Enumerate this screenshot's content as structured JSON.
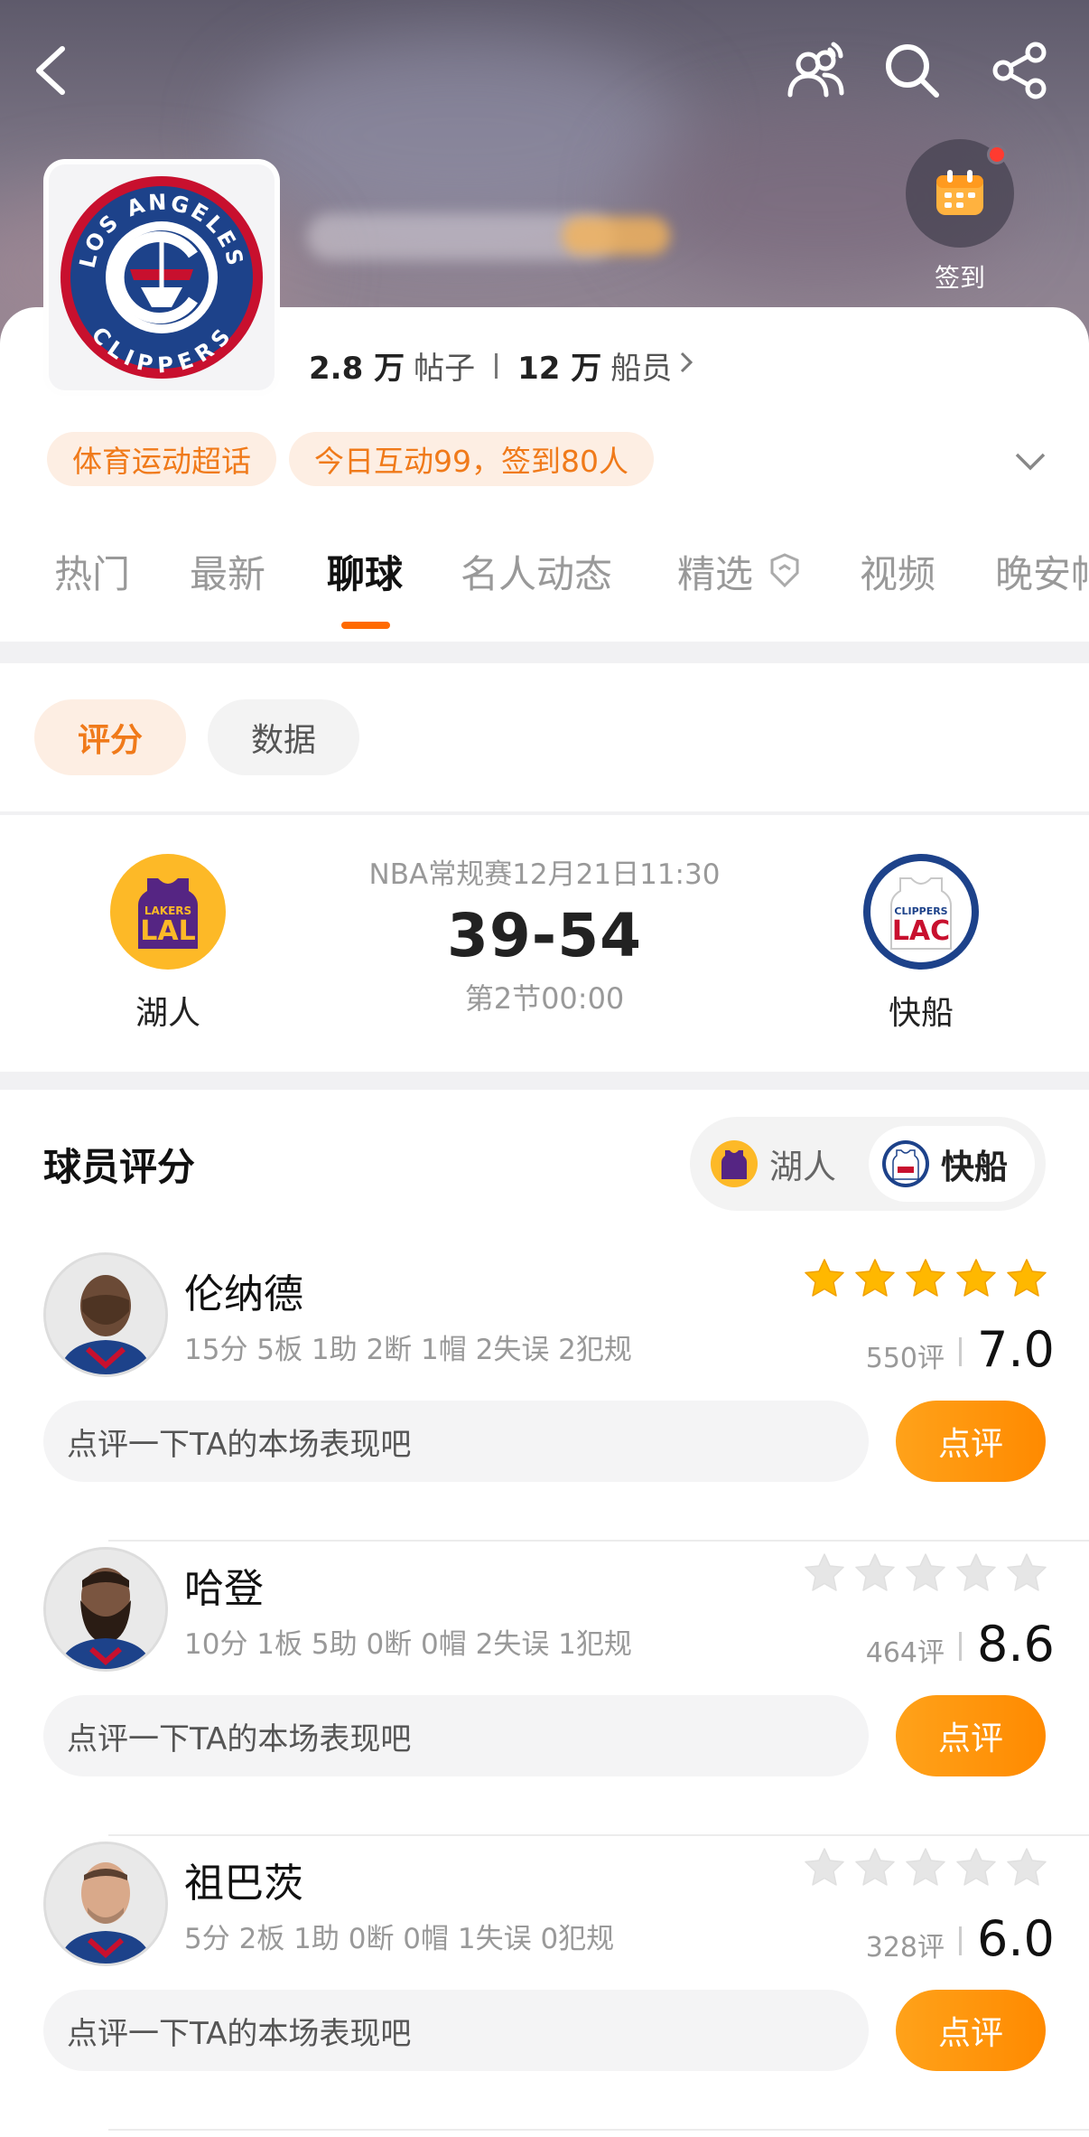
{
  "header": {
    "checkin_label": "签到",
    "stats": {
      "posts_num": "2.8 万",
      "posts_label": "帖子",
      "members_num": "12 万",
      "members_label": "船员"
    },
    "tags": [
      "体育运动超话",
      "今日互动99，签到80人"
    ],
    "tabs": [
      "热门",
      "最新",
      "聊球",
      "名人动态",
      "精选",
      "视频",
      "晚安帖"
    ],
    "active_tab": "聊球",
    "logo_text": {
      "top": "LOS ANGELES",
      "bottom": "CLIPPERS"
    }
  },
  "filters": {
    "rating": "评分",
    "data": "数据"
  },
  "match": {
    "info": "NBA常规赛12月21日11:30",
    "score": "39-54",
    "period": "第2节00:00",
    "home": {
      "abbr": "LAL",
      "badge": "LAKERS",
      "name": "湖人"
    },
    "away": {
      "abbr": "LAC",
      "badge": "CLIPPERS",
      "name": "快船"
    }
  },
  "ratings": {
    "title": "球员评分",
    "switch": {
      "lal": "湖人",
      "lac": "快船"
    },
    "players": [
      {
        "name": "伦纳德",
        "stats": "15分 5板 1助 2断 1帽 2失误 2犯规",
        "count": "550评",
        "score": "7.0",
        "stars_filled": 5,
        "comment_placeholder": "点评一下TA的本场表现吧",
        "button": "点评"
      },
      {
        "name": "哈登",
        "stats": "10分 1板 5助 0断 0帽 2失误 1犯规",
        "count": "464评",
        "score": "8.6",
        "stars_filled": 0,
        "comment_placeholder": "点评一下TA的本场表现吧",
        "button": "点评"
      },
      {
        "name": "祖巴茨",
        "stats": "5分 2板 1助 0断 0帽 1失误 0犯规",
        "count": "328评",
        "score": "6.0",
        "stars_filled": 0,
        "comment_placeholder": "点评一下TA的本场表现吧",
        "button": "点评"
      }
    ]
  },
  "colors": {
    "accent": "#ff8a00",
    "tag_bg": "#fdeee3",
    "tag_text": "#f07a1a",
    "star_on": "#ffb800",
    "star_off": "#e6e6e6"
  }
}
